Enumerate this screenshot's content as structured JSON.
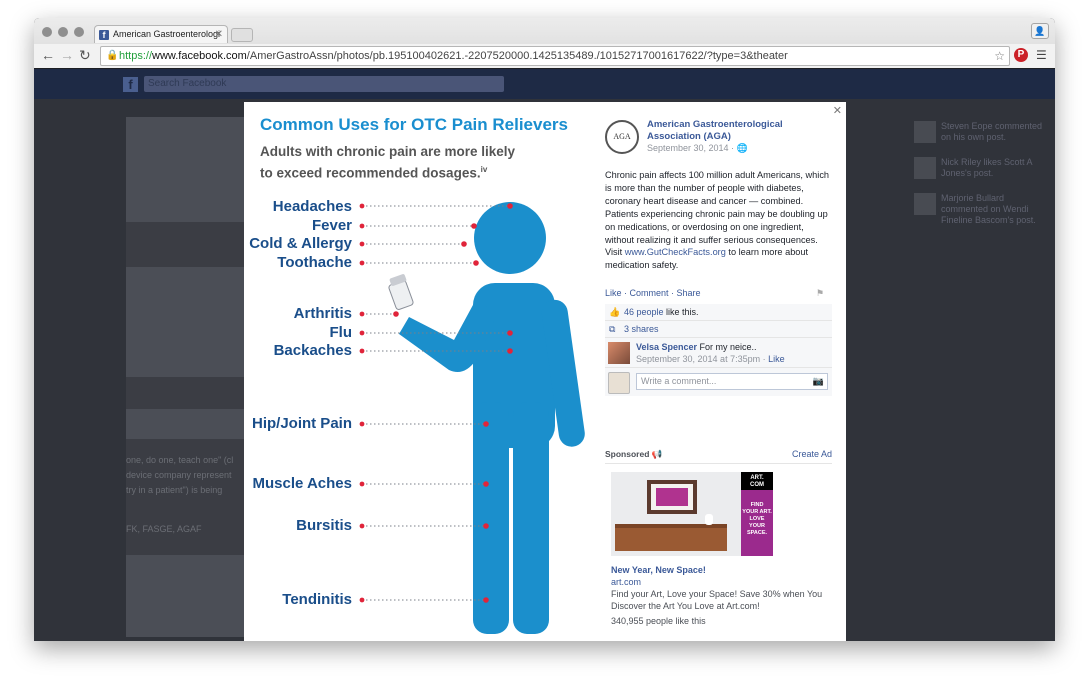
{
  "browser": {
    "tab_title": "American Gastroenterologi",
    "url_https": "https://",
    "url_domain": "www.facebook.com",
    "url_path": "/AmerGastroAssn/photos/pb.195100402621.-2207520000.1425135489./10152717001617622/?type=3&theater"
  },
  "facebook": {
    "search_placeholder": "Search Facebook"
  },
  "infographic": {
    "title": "Common Uses for OTC Pain Relievers",
    "subtitle_line1": "Adults with chronic pain are more likely",
    "subtitle_line2": "to exceed recommended dosages.",
    "subtitle_sup": "iv",
    "conditions": [
      "Headaches",
      "Fever",
      "Cold & Allergy",
      "Toothache",
      "Arthritis",
      "Flu",
      "Backaches",
      "Hip/Joint Pain",
      "Muscle Aches",
      "Bursitis",
      "Tendinitis"
    ],
    "colors": {
      "title": "#1a8ecf",
      "label": "#1a4e8a",
      "figure": "#1b8fcc",
      "dot": "#e0243a"
    }
  },
  "post": {
    "page_name": "American Gastroenterological Association (AGA)",
    "date": "September 30, 2014 · ",
    "body_before_link": "Chronic pain affects 100 million adult Americans, which is more than the number of people with diabetes, coronary heart disease and cancer — combined. Patients experiencing chronic pain may be doubling up on medications, or overdosing on one ingredient, without realizing it and suffer serious consequences. Visit ",
    "body_link": "www.GutCheckFacts.org",
    "body_after_link": " to learn more about medication safety.",
    "like": "Like",
    "comment": "Comment",
    "share": "Share",
    "likes_count_link": "46 people",
    "likes_suffix": " like this.",
    "shares": "3 shares",
    "comment_author": "Velsa Spencer",
    "comment_text": " For my neice..",
    "comment_time": "September 30, 2014 at 7:35pm · ",
    "comment_like": "Like",
    "write_placeholder": "Write a comment..."
  },
  "ad": {
    "sponsored": "Sponsored",
    "create_ad": "Create Ad",
    "headline": "New Year, New Space!",
    "domain": "art.com",
    "body": "Find your Art, Love your Space! Save 30% when You Discover the Art You Love at Art.com!",
    "likes": "340,955 people like this",
    "img_brand": "ART. COM",
    "img_tagline": "FIND YOUR ART. LOVE YOUR SPACE."
  },
  "ticker": [
    "Steven Eope commented on his own post.",
    "Nick Riley likes Scott A Jones's post.",
    "Marjorie Bullard commented on Wendi Fineline Bascom's post."
  ],
  "background": {
    "left_text1": "one, do one, teach one\" (cl",
    "left_text2": "device company represent",
    "left_text3": "try in a patient\") is being",
    "left_text4": "FK, FASGE, AGAF"
  }
}
